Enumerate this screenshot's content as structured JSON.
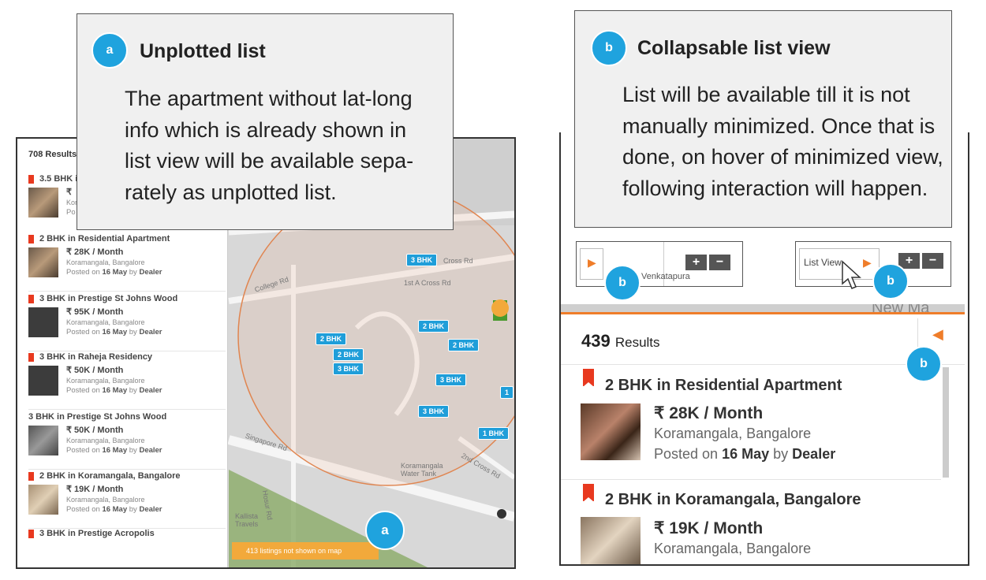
{
  "callout_a": {
    "badge": "a",
    "title": "Unplotted list",
    "body": "The apartment without lat-long info which is already shown in list view will be available sepa- rately as unplotted list."
  },
  "callout_b": {
    "badge": "b",
    "title": "Collapsable list view",
    "body": "List will be available till it is not manually minimized. Once that is done, on hover of minimized view, following interaction will happen."
  },
  "left_list": {
    "results": "708 Results",
    "items": [
      {
        "title": "3.5 BHK in",
        "price": "₹",
        "loc": "Kora",
        "posted": "Po"
      },
      {
        "title": "2 BHK in Residential Apartment",
        "price": "₹ 28K / Month",
        "loc": "Koramangala, Bangalore",
        "posted_pre": "Posted on",
        "date": "16 May",
        "by": "by",
        "dealer": "Dealer"
      },
      {
        "title": "3 BHK in Prestige St Johns Wood",
        "price": "₹ 95K / Month",
        "loc": "Koramangala, Bangalore",
        "posted_pre": "Posted on",
        "date": "16 May",
        "by": "by",
        "dealer": "Dealer"
      },
      {
        "title": "3 BHK in Raheja Residency",
        "price": "₹ 50K / Month",
        "loc": "Koramangala, Bangalore",
        "posted_pre": "Posted on",
        "date": "16 May",
        "by": "by",
        "dealer": "Dealer"
      },
      {
        "title": "3 BHK in Prestige St Johns Wood",
        "price": "₹ 50K / Month",
        "loc": "Koramangala, Bangalore",
        "posted_pre": "Posted on",
        "date": "16 May",
        "by": "by",
        "dealer": "Dealer"
      },
      {
        "title": "2 BHK in Koramangala, Bangalore",
        "price": "₹ 19K / Month",
        "loc": "Koramangala, Bangalore",
        "posted_pre": "Posted on",
        "date": "16 May",
        "by": "by",
        "dealer": "Dealer"
      },
      {
        "title": "3 BHK in Prestige Acropolis"
      }
    ],
    "unplotted": "413 listings not shown on map"
  },
  "map_pins": [
    "3 BHK",
    "2 BHK",
    "2 BHK",
    "2 BHK",
    "2 BHK",
    "3 BHK",
    "3 BHK",
    "3 BHK",
    "1 BHK",
    "1"
  ],
  "map_labels": {
    "cross_rd": "Cross Rd",
    "first_a_cross": "1st A Cross Rd",
    "college_rd": "College Rd",
    "singapore_rd": "Singapore Rd",
    "hosur_rd": "Hosur Rd",
    "water_tank": "Koramangala Water Tank",
    "cross_rd2": "2nd Cross Rd",
    "kallista": "Kallista Travels"
  },
  "mini_controls": {
    "list_view": "List View",
    "place": "Venkatapura",
    "plus": "+",
    "minus": "−",
    "arrow": "▶",
    "badge": "b"
  },
  "right_list": {
    "count": "439",
    "results_word": "Results",
    "map_text": "New Ma",
    "items": [
      {
        "title": "2 BHK in Residential Apartment",
        "price": "₹  28K / Month",
        "loc": "Koramangala, Bangalore",
        "posted_pre": "Posted on",
        "date": "16 May",
        "by": "by",
        "dealer": "Dealer"
      },
      {
        "title": "2 BHK in Koramangala, Bangalore",
        "price": "₹  19K / Month",
        "loc": "Koramangala, Bangalore"
      }
    ],
    "collapse_arrow": "◀",
    "badge": "b"
  },
  "colors": {
    "accent": "#1fa3de",
    "orange": "#ef7d2a",
    "flag": "#e8391f"
  }
}
